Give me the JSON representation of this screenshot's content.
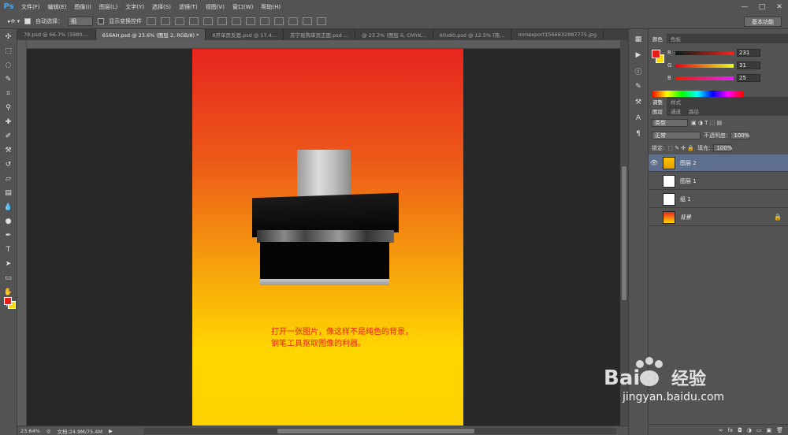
{
  "app": {
    "logo": "Ps",
    "menu": [
      "文件(F)",
      "编辑(E)",
      "图像(I)",
      "图层(L)",
      "文字(Y)",
      "选择(S)",
      "滤镜(T)",
      "视图(V)",
      "窗口(W)",
      "帮助(H)"
    ],
    "window_controls": [
      "—",
      "□",
      "✕"
    ]
  },
  "options_bar": {
    "auto_select_label": "自动选择：",
    "auto_select_value": "组",
    "show_transform_label": "显示变换控件",
    "workspace": "基本功能"
  },
  "tabs": [
    {
      "label": "78.psd @ 66.7% (3980,...",
      "active": false
    },
    {
      "label": "656AH.psd @ 23.6% (图层 2, RGB/8) *",
      "active": true
    },
    {
      "label": "8开单页反面.psd @ 17.4...",
      "active": false
    },
    {
      "label": "苏宁易购单页正面.psd ...",
      "active": false
    },
    {
      "label": "@ 23.2% (图层 6, CMYK...",
      "active": false
    },
    {
      "label": "60x80.psd @ 12.5% (热...",
      "active": false
    },
    {
      "label": "mmexport1566832987775.jpg",
      "active": false
    }
  ],
  "canvas": {
    "caption_line1": "打开一张图片，像这样不是纯色的背景，",
    "caption_line2": "钢笔工具抠取图像的利器。"
  },
  "status": {
    "zoom": "23.64%",
    "doc_size": "文档:24.9M/75.4M"
  },
  "color_panel": {
    "tabs": [
      "颜色",
      "色板"
    ],
    "r_label": "R",
    "r_value": "231",
    "g_label": "G",
    "g_value": "31",
    "b_label": "B",
    "b_value": "25",
    "fg_color": "#e71f19",
    "bg_color": "#ffd800"
  },
  "layers_panel": {
    "top_tabs": [
      "调整",
      "样式"
    ],
    "tabs": [
      "图层",
      "通道",
      "路径"
    ],
    "kind_label": "类型",
    "blend_mode": "正常",
    "opacity_label": "不透明度:",
    "opacity_value": "100%",
    "lock_label": "锁定:",
    "fill_label": "填充:",
    "fill_value": "100%",
    "layers": [
      {
        "name": "图层 2",
        "selected": true,
        "visible": true
      },
      {
        "name": "图层 1",
        "selected": false,
        "visible": false
      },
      {
        "name": "组 1",
        "selected": false,
        "visible": false
      },
      {
        "name": "背景",
        "selected": false,
        "visible": false
      }
    ],
    "footer_icons": [
      "link-icon",
      "fx-icon",
      "mask-icon",
      "adjustment-icon",
      "folder-icon",
      "new-layer-icon",
      "trash-icon"
    ],
    "footer_glyphs": [
      "∞",
      "fx",
      "◘",
      "◑",
      "▭",
      "▣",
      "🗑"
    ]
  },
  "watermark": {
    "text": "jingyan.baidu.com"
  }
}
